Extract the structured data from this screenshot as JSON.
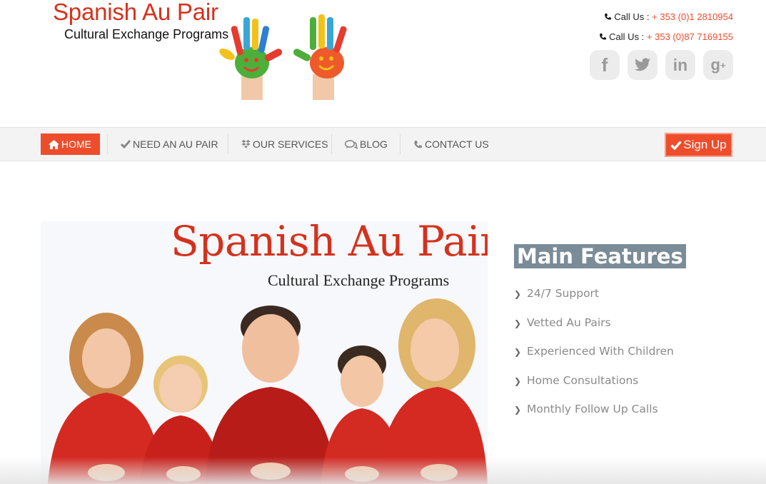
{
  "header": {
    "logo": {
      "title": "Spanish Au Pair",
      "subtitle": "Cultural Exchange Programs"
    },
    "contacts": [
      {
        "label": "Call Us :",
        "number": "+ 353 (0)1 2810954"
      },
      {
        "label": "Call Us :",
        "number": "+ 353 (0)87 7169155"
      }
    ],
    "socials": [
      {
        "icon": "facebook-icon",
        "glyph": "f"
      },
      {
        "icon": "twitter-icon",
        "glyph": "t"
      },
      {
        "icon": "linkedin-icon",
        "glyph": "in"
      },
      {
        "icon": "google-plus-icon",
        "glyph": "g+"
      }
    ]
  },
  "nav": {
    "items": [
      {
        "label": "HOME",
        "icon": "home-icon",
        "active": true
      },
      {
        "label": "NEED AN AU PAIR",
        "icon": "check-icon"
      },
      {
        "label": "OUR SERVICES",
        "icon": "dropbox-icon"
      },
      {
        "label": "BLOG",
        "icon": "comments-icon"
      },
      {
        "label": "CONTACT US",
        "icon": "phone-icon"
      }
    ],
    "signup_label": "Sign Up"
  },
  "hero": {
    "title": "Spanish Au Pair",
    "subtitle": "Cultural Exchange Programs"
  },
  "features": {
    "title": "Main Features",
    "items": [
      "24/7 Support",
      "Vetted Au Pairs",
      "Experienced With Children",
      "Home Consultations",
      "Monthly Follow Up Calls"
    ]
  },
  "colors": {
    "accent": "#ee4d2c",
    "brand_red": "#d4321d",
    "feature_title_bg": "#7a8c97"
  }
}
